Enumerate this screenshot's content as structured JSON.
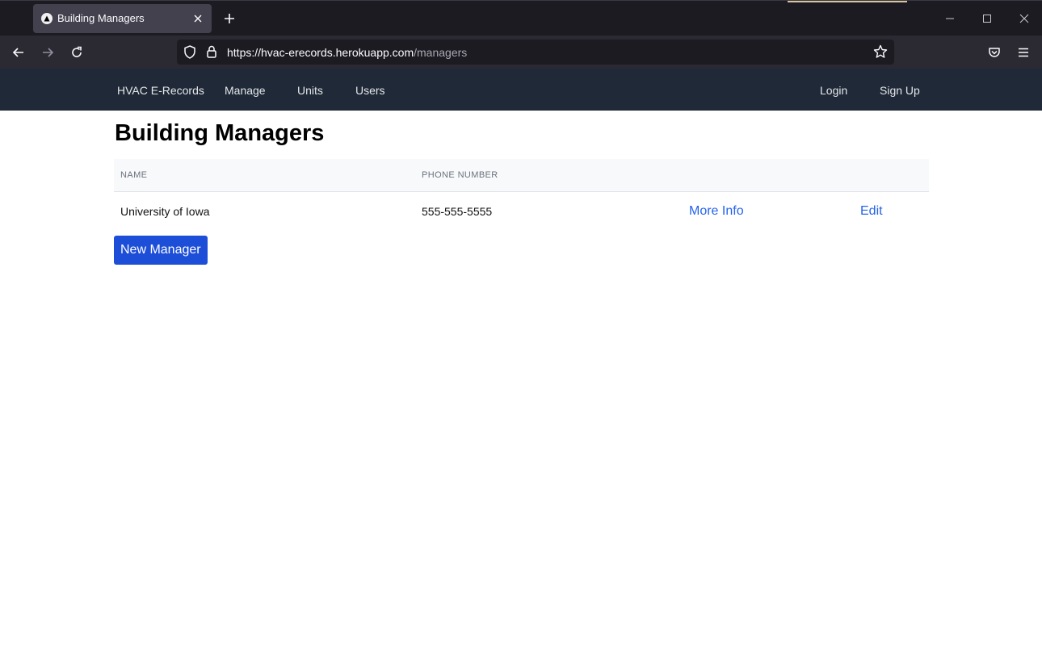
{
  "browser": {
    "tab_title": "Building Managers",
    "url_host": "https://hvac-erecords.herokuapp.com",
    "url_path": "/managers"
  },
  "navbar": {
    "brand": "HVAC E-Records",
    "links": [
      "Manage",
      "Units",
      "Users"
    ],
    "login": "Login",
    "signup": "Sign Up"
  },
  "page": {
    "title": "Building Managers",
    "table": {
      "headers": [
        "NAME",
        "PHONE NUMBER"
      ],
      "rows": [
        {
          "name": "University of Iowa",
          "phone": "555-555-5555",
          "more_info": "More Info",
          "edit": "Edit"
        }
      ]
    },
    "new_button": "New Manager"
  },
  "colors": {
    "navbar_bg": "#1f2937",
    "link": "#2563eb",
    "primary_button": "#1d4ed8"
  }
}
